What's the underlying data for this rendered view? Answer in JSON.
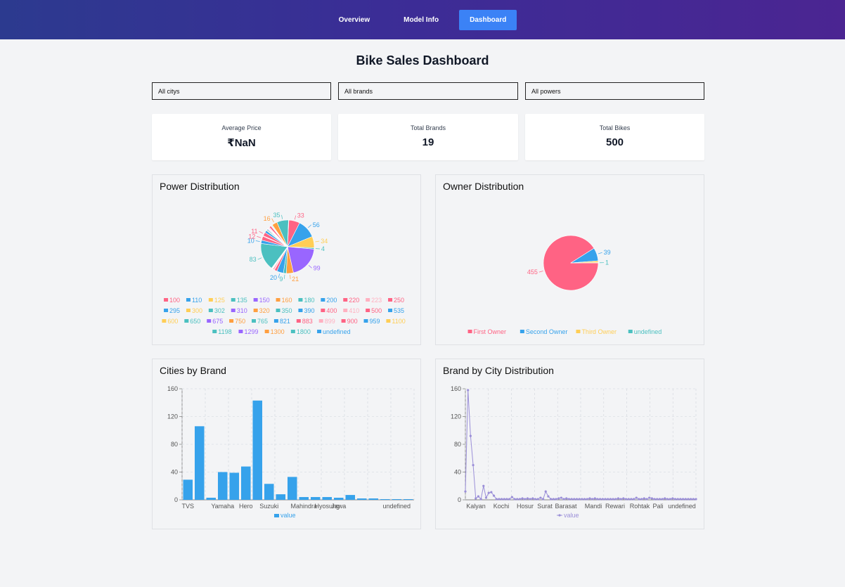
{
  "nav": {
    "items": [
      "Overview",
      "Model Info",
      "Dashboard"
    ],
    "active": "Dashboard"
  },
  "page": {
    "title": "Bike Sales Dashboard"
  },
  "filters": {
    "city": "All citys",
    "brand": "All brands",
    "power": "All powers"
  },
  "stats": [
    {
      "label": "Average Price",
      "value": "₹NaN"
    },
    {
      "label": "Total Brands",
      "value": "19"
    },
    {
      "label": "Total Bikes",
      "value": "500"
    }
  ],
  "colors": {
    "palette": [
      "#ff6384",
      "#36a2eb",
      "#ffce56",
      "#4bc0c0",
      "#9966ff",
      "#ff9f40",
      "#4bc0c0",
      "#36a2eb",
      "#ff6384",
      "#ffb1c1"
    ],
    "line": "#9b8fd8",
    "bar": "#36a2eb"
  },
  "power_chart": {
    "title": "Power Distribution",
    "legend": [
      "100",
      "110",
      "125",
      "135",
      "150",
      "160",
      "180",
      "200",
      "220",
      "223",
      "250",
      "295",
      "300",
      "302",
      "310",
      "320",
      "350",
      "390",
      "400",
      "410",
      "500",
      "535",
      "600",
      "650",
      "675",
      "750",
      "765",
      "821",
      "883",
      "899",
      "900",
      "959",
      "1100",
      "1198",
      "1299",
      "1300",
      "1800",
      "undefined"
    ]
  },
  "owner_chart": {
    "title": "Owner Distribution",
    "legend": [
      "First Owner",
      "Second Owner",
      "Third Owner",
      "undefined"
    ]
  },
  "brand_chart": {
    "title": "Cities by Brand",
    "legend": "value"
  },
  "city_chart": {
    "title": "Brand by City Distribution",
    "legend": "value"
  },
  "chart_data": [
    {
      "type": "pie",
      "title": "Power Distribution",
      "categories": [
        "100",
        "110",
        "125",
        "135",
        "150",
        "160",
        "180",
        "200",
        "220",
        "223",
        "250",
        "295",
        "300",
        "302",
        "310",
        "320",
        "350",
        "390",
        "400",
        "410",
        "500",
        "535",
        "600",
        "650",
        "675",
        "750",
        "765",
        "821",
        "883",
        "899",
        "900",
        "959",
        "1100",
        "1198",
        "1299",
        "1300",
        "1800",
        "undefined"
      ],
      "values": [
        33,
        56,
        34,
        4,
        99,
        21,
        9,
        20,
        8,
        2,
        3,
        1,
        1,
        1,
        1,
        1,
        83,
        10,
        12,
        2,
        11,
        7,
        2,
        3,
        2,
        1,
        1,
        1,
        2,
        1,
        6,
        1,
        1,
        2,
        1,
        16,
        35,
        1
      ],
      "shown_labels": [
        "99",
        "4",
        "34",
        "20",
        "33",
        "83",
        "10",
        "12",
        "11",
        "35",
        "16",
        "56",
        "9",
        "21"
      ]
    },
    {
      "type": "pie",
      "title": "Owner Distribution",
      "categories": [
        "First Owner",
        "Second Owner",
        "Third Owner",
        "undefined"
      ],
      "values": [
        455,
        39,
        5,
        1
      ],
      "shown_labels": [
        "455",
        "39",
        "1",
        "1"
      ]
    },
    {
      "type": "bar",
      "title": "Cities by Brand",
      "categories": [
        "TVS",
        "",
        "Yamaha",
        "Hero",
        "",
        "Suzuki",
        "",
        "Mahindra",
        "",
        "",
        "Hyosung",
        "Jawa",
        "",
        "",
        "undefined",
        ""
      ],
      "tick_labels": [
        "TVS",
        "Yamaha",
        "Hero",
        "Suzuki",
        "Mahindra",
        "Hyosung",
        "Jawa",
        "undefined"
      ],
      "values": [
        29,
        106,
        3,
        40,
        39,
        48,
        143,
        23,
        8,
        33,
        4,
        4,
        4,
        3,
        7,
        2,
        2,
        1,
        1,
        1
      ],
      "ylim": [
        0,
        160
      ],
      "yticks": [
        0,
        40,
        80,
        120,
        160
      ],
      "series_name": "value"
    },
    {
      "type": "line",
      "title": "Brand by City Distribution",
      "tick_labels": [
        "Kalyan",
        "Kochi",
        "Hosur",
        "Surat",
        "Barasat",
        "Mandi",
        "Rewari",
        "Rohtak",
        "Pali",
        "undefined"
      ],
      "values": [
        12,
        158,
        92,
        50,
        2,
        5,
        1,
        20,
        3,
        10,
        11,
        6,
        1,
        1,
        1,
        1,
        1,
        1,
        4,
        1,
        1,
        1,
        2,
        1,
        2,
        1,
        2,
        1,
        1,
        3,
        1,
        12,
        5,
        1,
        1,
        1,
        2,
        3,
        1,
        2,
        1,
        1,
        1,
        1,
        1,
        1,
        1,
        1,
        2,
        1,
        2,
        1,
        1,
        1,
        1,
        1,
        1,
        1,
        1,
        2,
        1,
        2,
        1,
        1,
        1,
        1,
        3,
        1,
        1,
        2,
        1,
        3,
        2,
        1,
        1,
        1,
        1,
        2,
        1,
        1,
        2,
        1,
        1,
        1,
        1,
        1,
        1,
        1,
        1,
        1
      ],
      "ylim": [
        0,
        160
      ],
      "yticks": [
        0,
        40,
        80,
        120,
        160
      ],
      "series_name": "value"
    }
  ]
}
